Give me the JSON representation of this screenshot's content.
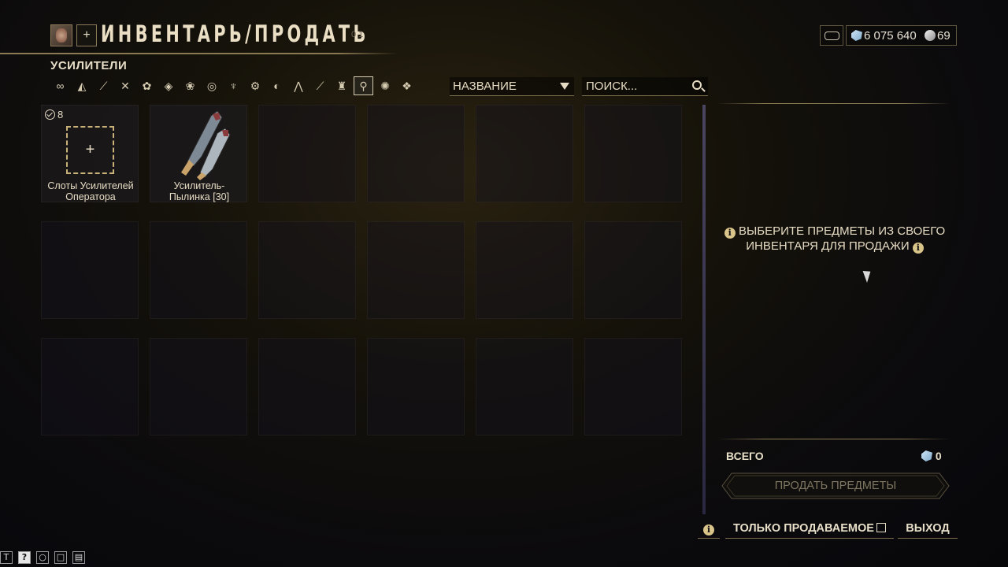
{
  "header": {
    "title": "ИНВЕНТАРЬ/ПРОДАТЬ",
    "add_label": "+",
    "decoration": "01"
  },
  "currency": {
    "credits": "6 075 640",
    "platinum": "69"
  },
  "category": {
    "label": "УСИЛИТЕЛИ",
    "filters": [
      "all-icon",
      "warframe-icon",
      "primary-weapon-icon",
      "secondary-weapon-icon",
      "melee-icon",
      "companion-icon",
      "archwing-icon",
      "mod-icon",
      "arcane-icon",
      "relic-icon",
      "necramech-icon",
      "kdrive-icon",
      "zaw-icon",
      "kitgun-icon",
      "amp-icon",
      "resource-icon",
      "misc-icon"
    ],
    "active_filter_index": 14
  },
  "sort": {
    "label": "НАЗВАНИЕ"
  },
  "search": {
    "placeholder": "ПОИСК..."
  },
  "grid": {
    "items": [
      {
        "type": "slots",
        "count": "8",
        "label_line1": "Слоты Усилителей",
        "label_line2": "Оператора",
        "add_label": "+"
      },
      {
        "type": "item",
        "label_line1": "Усилитель-",
        "label_line2": "Пылинка [30]"
      }
    ]
  },
  "panel": {
    "hint_line1": "ВЫБЕРИТЕ ПРЕДМЕТЫ ИЗ СВОЕГО",
    "hint_line2": "ИНВЕНТАРЯ ДЛЯ ПРОДАЖИ",
    "info_glyph": "i",
    "total_label": "ВСЕГО",
    "total_value": "0",
    "sell_button": "ПРОДАТЬ ПРЕДМЕТЫ"
  },
  "footer": {
    "info_glyph": "i",
    "sellable_toggle": "ТОЛЬКО ПРОДАВАЕМОЕ",
    "exit": "ВЫХОД"
  },
  "mini_toolbar": [
    "T",
    "?",
    "○",
    "□",
    "▤"
  ],
  "colors": {
    "accent_gold": "#c9b27a",
    "text": "#e6dcc4",
    "disabled": "#7e7660"
  }
}
